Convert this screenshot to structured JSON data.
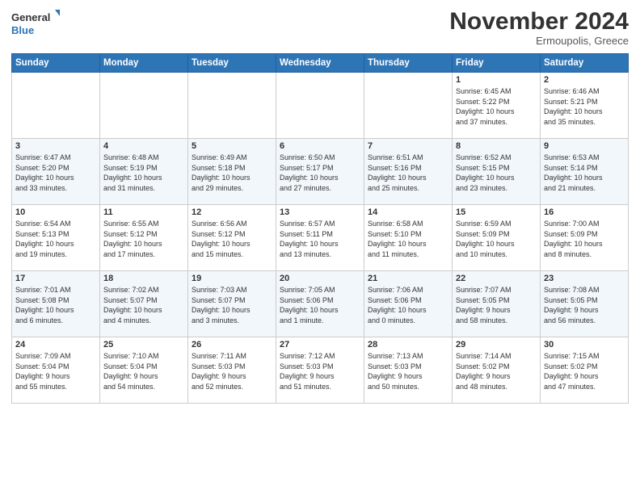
{
  "header": {
    "logo_line1": "General",
    "logo_line2": "Blue",
    "month": "November 2024",
    "location": "Ermoupolis, Greece"
  },
  "weekdays": [
    "Sunday",
    "Monday",
    "Tuesday",
    "Wednesday",
    "Thursday",
    "Friday",
    "Saturday"
  ],
  "weeks": [
    [
      {
        "day": "",
        "info": ""
      },
      {
        "day": "",
        "info": ""
      },
      {
        "day": "",
        "info": ""
      },
      {
        "day": "",
        "info": ""
      },
      {
        "day": "",
        "info": ""
      },
      {
        "day": "1",
        "info": "Sunrise: 6:45 AM\nSunset: 5:22 PM\nDaylight: 10 hours\nand 37 minutes."
      },
      {
        "day": "2",
        "info": "Sunrise: 6:46 AM\nSunset: 5:21 PM\nDaylight: 10 hours\nand 35 minutes."
      }
    ],
    [
      {
        "day": "3",
        "info": "Sunrise: 6:47 AM\nSunset: 5:20 PM\nDaylight: 10 hours\nand 33 minutes."
      },
      {
        "day": "4",
        "info": "Sunrise: 6:48 AM\nSunset: 5:19 PM\nDaylight: 10 hours\nand 31 minutes."
      },
      {
        "day": "5",
        "info": "Sunrise: 6:49 AM\nSunset: 5:18 PM\nDaylight: 10 hours\nand 29 minutes."
      },
      {
        "day": "6",
        "info": "Sunrise: 6:50 AM\nSunset: 5:17 PM\nDaylight: 10 hours\nand 27 minutes."
      },
      {
        "day": "7",
        "info": "Sunrise: 6:51 AM\nSunset: 5:16 PM\nDaylight: 10 hours\nand 25 minutes."
      },
      {
        "day": "8",
        "info": "Sunrise: 6:52 AM\nSunset: 5:15 PM\nDaylight: 10 hours\nand 23 minutes."
      },
      {
        "day": "9",
        "info": "Sunrise: 6:53 AM\nSunset: 5:14 PM\nDaylight: 10 hours\nand 21 minutes."
      }
    ],
    [
      {
        "day": "10",
        "info": "Sunrise: 6:54 AM\nSunset: 5:13 PM\nDaylight: 10 hours\nand 19 minutes."
      },
      {
        "day": "11",
        "info": "Sunrise: 6:55 AM\nSunset: 5:12 PM\nDaylight: 10 hours\nand 17 minutes."
      },
      {
        "day": "12",
        "info": "Sunrise: 6:56 AM\nSunset: 5:12 PM\nDaylight: 10 hours\nand 15 minutes."
      },
      {
        "day": "13",
        "info": "Sunrise: 6:57 AM\nSunset: 5:11 PM\nDaylight: 10 hours\nand 13 minutes."
      },
      {
        "day": "14",
        "info": "Sunrise: 6:58 AM\nSunset: 5:10 PM\nDaylight: 10 hours\nand 11 minutes."
      },
      {
        "day": "15",
        "info": "Sunrise: 6:59 AM\nSunset: 5:09 PM\nDaylight: 10 hours\nand 10 minutes."
      },
      {
        "day": "16",
        "info": "Sunrise: 7:00 AM\nSunset: 5:09 PM\nDaylight: 10 hours\nand 8 minutes."
      }
    ],
    [
      {
        "day": "17",
        "info": "Sunrise: 7:01 AM\nSunset: 5:08 PM\nDaylight: 10 hours\nand 6 minutes."
      },
      {
        "day": "18",
        "info": "Sunrise: 7:02 AM\nSunset: 5:07 PM\nDaylight: 10 hours\nand 4 minutes."
      },
      {
        "day": "19",
        "info": "Sunrise: 7:03 AM\nSunset: 5:07 PM\nDaylight: 10 hours\nand 3 minutes."
      },
      {
        "day": "20",
        "info": "Sunrise: 7:05 AM\nSunset: 5:06 PM\nDaylight: 10 hours\nand 1 minute."
      },
      {
        "day": "21",
        "info": "Sunrise: 7:06 AM\nSunset: 5:06 PM\nDaylight: 10 hours\nand 0 minutes."
      },
      {
        "day": "22",
        "info": "Sunrise: 7:07 AM\nSunset: 5:05 PM\nDaylight: 9 hours\nand 58 minutes."
      },
      {
        "day": "23",
        "info": "Sunrise: 7:08 AM\nSunset: 5:05 PM\nDaylight: 9 hours\nand 56 minutes."
      }
    ],
    [
      {
        "day": "24",
        "info": "Sunrise: 7:09 AM\nSunset: 5:04 PM\nDaylight: 9 hours\nand 55 minutes."
      },
      {
        "day": "25",
        "info": "Sunrise: 7:10 AM\nSunset: 5:04 PM\nDaylight: 9 hours\nand 54 minutes."
      },
      {
        "day": "26",
        "info": "Sunrise: 7:11 AM\nSunset: 5:03 PM\nDaylight: 9 hours\nand 52 minutes."
      },
      {
        "day": "27",
        "info": "Sunrise: 7:12 AM\nSunset: 5:03 PM\nDaylight: 9 hours\nand 51 minutes."
      },
      {
        "day": "28",
        "info": "Sunrise: 7:13 AM\nSunset: 5:03 PM\nDaylight: 9 hours\nand 50 minutes."
      },
      {
        "day": "29",
        "info": "Sunrise: 7:14 AM\nSunset: 5:02 PM\nDaylight: 9 hours\nand 48 minutes."
      },
      {
        "day": "30",
        "info": "Sunrise: 7:15 AM\nSunset: 5:02 PM\nDaylight: 9 hours\nand 47 minutes."
      }
    ]
  ]
}
